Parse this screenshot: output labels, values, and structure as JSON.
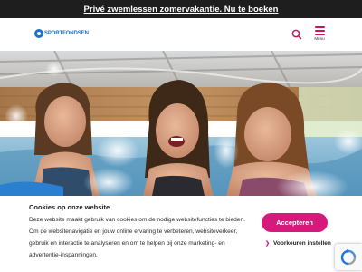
{
  "promo_banner": {
    "text": "Privé zwemlessen zomervakantie. Nu te boeken"
  },
  "header": {
    "logo_text": "SPORTFONDSEN",
    "search_icon": "search-icon",
    "menu_icon": "hamburger-menu-icon",
    "menu_label": "Menu"
  },
  "hero": {
    "image_subject": "three-children-in-swimming-pool-photo"
  },
  "cookie_banner": {
    "title": "Cookies op onze website",
    "text": "Deze website maakt gebruik van cookies om de nodige websitefuncties te bieden. Om de websitenavigatie en jouw online ervaring te verbeteren, websiteverkeer, gebruik en interactie te analyseren en om te helpen bij onze marketing- en advertentie-inspanningen.",
    "accept_label": "Accepteren",
    "preferences_label": "Voorkeuren instellen"
  },
  "colors": {
    "accent": "#d6197a",
    "brand_blue": "#1b73c9",
    "promo_bg": "#1e1e1e"
  }
}
